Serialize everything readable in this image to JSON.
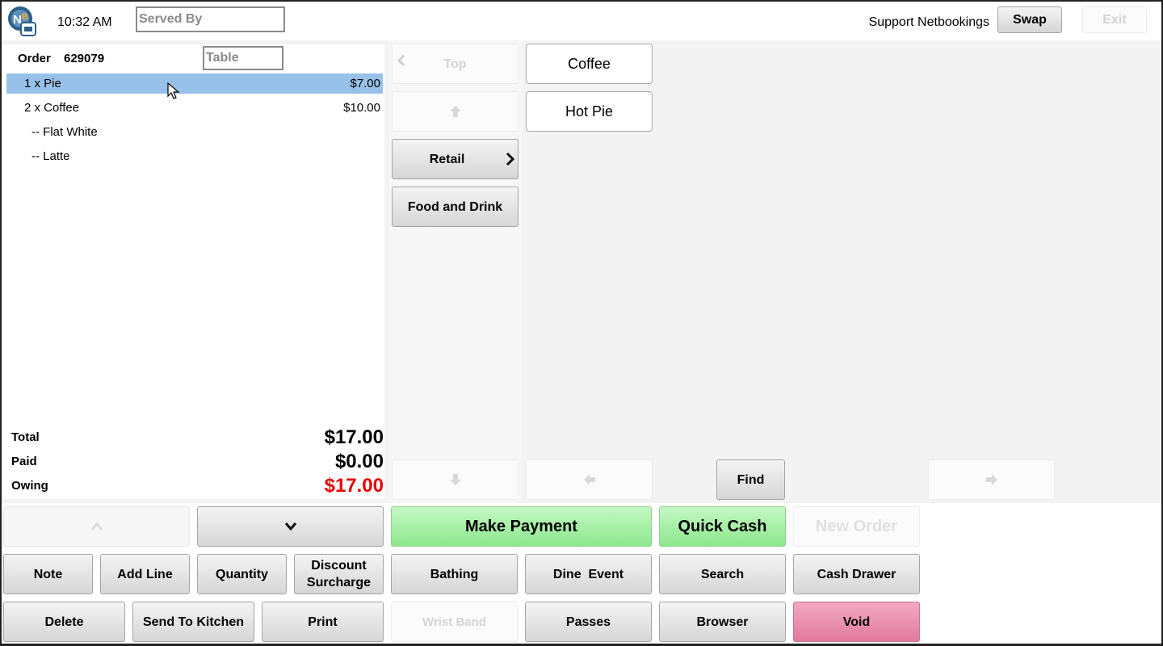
{
  "header": {
    "time": "10:32 AM",
    "served_by_placeholder": "Served By",
    "user": "Support Netbookings",
    "swap_label": "Swap",
    "exit_label": "Exit"
  },
  "order": {
    "label": "Order",
    "number": "629079",
    "table_placeholder": "Table",
    "lines": [
      {
        "text": "1 x Pie",
        "amount": "$7.00",
        "selected": true,
        "indent": 0
      },
      {
        "text": "2 x Coffee",
        "amount": "$10.00",
        "selected": false,
        "indent": 0
      },
      {
        "text": "-- Flat White",
        "amount": "",
        "selected": false,
        "indent": 1
      },
      {
        "text": "-- Latte",
        "amount": "",
        "selected": false,
        "indent": 1
      }
    ],
    "totals": {
      "total_label": "Total",
      "total_value": "$17.00",
      "paid_label": "Paid",
      "paid_value": "$0.00",
      "owing_label": "Owing",
      "owing_value": "$17.00"
    }
  },
  "categories": {
    "top_label": "Top",
    "items": [
      "Retail",
      "Food and Drink"
    ]
  },
  "products": {
    "items": [
      "Coffee",
      "Hot Pie"
    ],
    "find_label": "Find"
  },
  "actions": {
    "make_payment": "Make Payment",
    "quick_cash": "Quick Cash",
    "new_order": "New Order",
    "note": "Note",
    "add_line": "Add Line",
    "quantity": "Quantity",
    "discount": "Discount",
    "surcharge": "Surcharge",
    "bathing": "Bathing",
    "dine_event": "Dine  Event",
    "search": "Search",
    "cash_drawer": "Cash Drawer",
    "delete": "Delete",
    "send_to_kitchen": "Send To Kitchen",
    "print": "Print",
    "wrist_band": "Wrist Band",
    "passes": "Passes",
    "browser": "Browser",
    "void": "Void"
  },
  "colors": {
    "selected_row": "#97c1e8",
    "payment_green": "#a8f0a8",
    "void_pink": "#e88aab",
    "owing_red": "#e30000"
  }
}
